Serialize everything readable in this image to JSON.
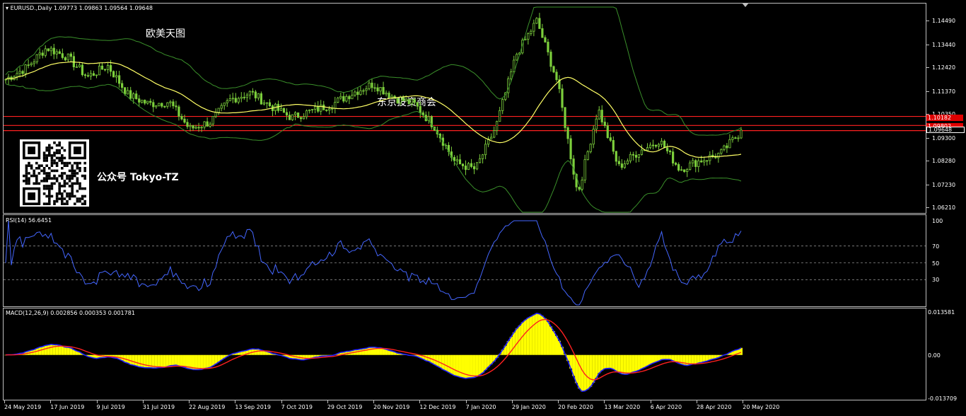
{
  "main_panel": {
    "title": "EURUSD.,Daily  1.09773 1.09863 1.09564 1.09648",
    "watermark_top": "欧美天图",
    "watermark_mid": "东京投资商会",
    "watermark_account": "公众号 Tokyo-TZ",
    "qr_icon": "qr-code-icon",
    "price_labels": [
      "1.14490",
      "1.13440",
      "1.12420",
      "1.11370",
      "1.10350",
      "1.09300",
      "1.08280",
      "1.07230",
      "1.06210"
    ],
    "price_tags": [
      {
        "text": "1.10182",
        "color": "#e00000"
      },
      {
        "text": "1.09802",
        "color": "#e00000"
      },
      {
        "text": "1.09648",
        "color": "#ffffff"
      }
    ],
    "horizontal_lines": [
      1.1025,
      1.0985,
      1.0962
    ],
    "colors": {
      "candle": "#7ccf3c",
      "ma": "#ffff66",
      "bands": "#3a8f2a",
      "hline": "#ff2020"
    }
  },
  "rsi_panel": {
    "title": "RSI(14) 56.6451",
    "levels": [
      "100",
      "70",
      "50",
      "30",
      "0"
    ],
    "color": "#4466ff"
  },
  "macd_panel": {
    "title": "MACD(12,26,9) 0.002856 0.000353 0.001781",
    "levels": [
      "0.013581",
      "0.00",
      "-0.013709"
    ],
    "colors": {
      "histogram": "#ffff00",
      "main": "#2020ff",
      "signal": "#ff2020"
    }
  },
  "chart_data": {
    "type": "candlestick",
    "symbol": "EURUSD.",
    "timeframe": "Daily",
    "last_bar": {
      "open": 1.09773,
      "high": 1.09863,
      "low": 1.09564,
      "close": 1.09648
    },
    "x_dates": [
      "24 May 2019",
      "17 Jun 2019",
      "9 Jul 2019",
      "31 Jul 2019",
      "22 Aug 2019",
      "13 Sep 2019",
      "7 Oct 2019",
      "29 Oct 2019",
      "20 Nov 2019",
      "12 Dec 2019",
      "7 Jan 2020",
      "29 Jan 2020",
      "20 Feb 2020",
      "13 Mar 2020",
      "6 Apr 2020",
      "28 Apr 2020",
      "20 May 2020"
    ],
    "price_close_approx": [
      1.119,
      1.124,
      1.133,
      1.129,
      1.12,
      1.125,
      1.112,
      1.108,
      1.109,
      1.097,
      1.1,
      1.11,
      1.113,
      1.107,
      1.102,
      1.105,
      1.108,
      1.113,
      1.117,
      1.111,
      1.108,
      1.098,
      1.082,
      1.079,
      1.098,
      1.13,
      1.145,
      1.118,
      1.068,
      1.106,
      1.08,
      1.087,
      1.092,
      1.079,
      1.083,
      1.086,
      1.096
    ],
    "ylim": [
      1.06,
      1.151
    ],
    "rsi_ylim": [
      0,
      100
    ],
    "macd_ylim": [
      -0.013709,
      0.013581
    ]
  }
}
